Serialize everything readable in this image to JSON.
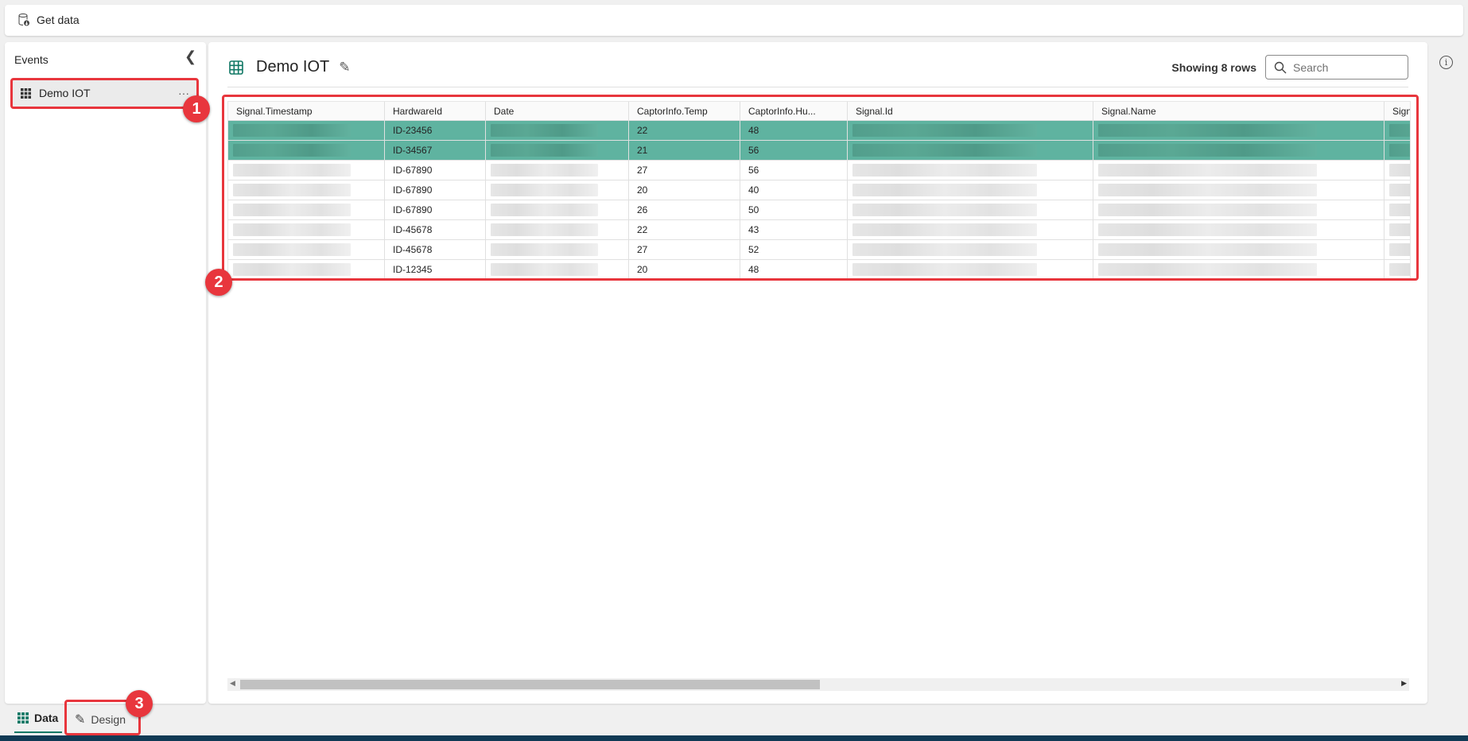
{
  "toolbar": {
    "get_data_label": "Get data",
    "get_data_icon": "database-download-icon"
  },
  "sidebar": {
    "title": "Events",
    "items": [
      {
        "label": "Demo IOT",
        "icon": "table-grid-icon",
        "more": "···"
      }
    ]
  },
  "main": {
    "title": "Demo IOT",
    "row_count_label": "Showing 8 rows",
    "search": {
      "placeholder": "Search",
      "value": ""
    },
    "table": {
      "columns": [
        "Signal.Timestamp",
        "HardwareId",
        "Date",
        "CaptorInfo.Temp",
        "CaptorInfo.Hu...",
        "Signal.Id",
        "Signal.Name",
        "Sign"
      ],
      "rows": [
        {
          "HardwareId": "ID-23456",
          "Temp": "22",
          "Humidity": "48",
          "selected": true
        },
        {
          "HardwareId": "ID-34567",
          "Temp": "21",
          "Humidity": "56",
          "selected": true
        },
        {
          "HardwareId": "ID-67890",
          "Temp": "27",
          "Humidity": "56",
          "selected": false
        },
        {
          "HardwareId": "ID-67890",
          "Temp": "20",
          "Humidity": "40",
          "selected": false
        },
        {
          "HardwareId": "ID-67890",
          "Temp": "26",
          "Humidity": "50",
          "selected": false
        },
        {
          "HardwareId": "ID-45678",
          "Temp": "22",
          "Humidity": "43",
          "selected": false
        },
        {
          "HardwareId": "ID-45678",
          "Temp": "27",
          "Humidity": "52",
          "selected": false
        },
        {
          "HardwareId": "ID-12345",
          "Temp": "20",
          "Humidity": "48",
          "selected": false
        }
      ]
    }
  },
  "bottom_tabs": [
    {
      "label": "Data",
      "active": true
    },
    {
      "label": "Design",
      "active": false
    }
  ],
  "annotations": [
    "1",
    "2",
    "3"
  ],
  "colors": {
    "accent": "#117865",
    "selected_row": "#5fb3a0",
    "annotation": "#e8363d"
  }
}
